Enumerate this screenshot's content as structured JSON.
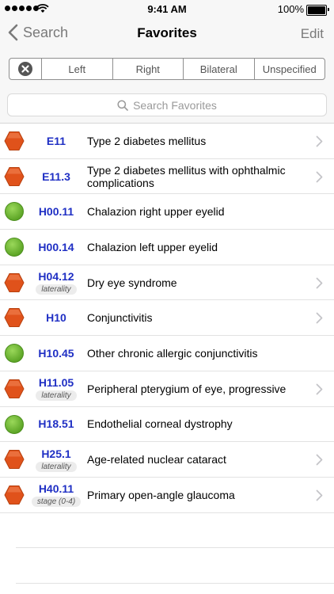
{
  "status": {
    "time": "9:41 AM",
    "battery": "100%"
  },
  "nav": {
    "back_label": "Search",
    "title": "Favorites",
    "edit_label": "Edit"
  },
  "filter": {
    "segments": [
      "Left",
      "Right",
      "Bilateral",
      "Unspecified"
    ]
  },
  "search": {
    "placeholder": "Search Favorites"
  },
  "colors": {
    "hexagon": "#e0521b",
    "circle": "#6cbb2f",
    "code": "#1f2fc4",
    "tint": "#7a7a7a"
  },
  "favorites": [
    {
      "code": "E11",
      "tag": "",
      "description": "Type 2 diabetes mellitus",
      "icon": "orange-hexagon",
      "chevron": true
    },
    {
      "code": "E11.3",
      "tag": "",
      "description": "Type 2 diabetes mellitus with ophthalmic complications",
      "icon": "orange-hexagon",
      "chevron": true
    },
    {
      "code": "H00.11",
      "tag": "",
      "description": "Chalazion right upper eyelid",
      "icon": "green-circle",
      "chevron": false
    },
    {
      "code": "H00.14",
      "tag": "",
      "description": "Chalazion left upper eyelid",
      "icon": "green-circle",
      "chevron": false
    },
    {
      "code": "H04.12",
      "tag": "laterality",
      "description": "Dry eye syndrome",
      "icon": "orange-hexagon",
      "chevron": true
    },
    {
      "code": "H10",
      "tag": "",
      "description": "Conjunctivitis",
      "icon": "orange-hexagon",
      "chevron": true
    },
    {
      "code": "H10.45",
      "tag": "",
      "description": "Other chronic allergic conjunctivitis",
      "icon": "green-circle",
      "chevron": false
    },
    {
      "code": "H11.05",
      "tag": "laterality",
      "description": "Peripheral pterygium of eye, progressive",
      "icon": "orange-hexagon",
      "chevron": true
    },
    {
      "code": "H18.51",
      "tag": "",
      "description": "Endothelial corneal dystrophy",
      "icon": "green-circle",
      "chevron": false
    },
    {
      "code": "H25.1",
      "tag": "laterality",
      "description": "Age-related nuclear cataract",
      "icon": "orange-hexagon",
      "chevron": true
    },
    {
      "code": "H40.11",
      "tag": "stage (0-4)",
      "description": "Primary open-angle glaucoma",
      "icon": "orange-hexagon",
      "chevron": true
    }
  ]
}
